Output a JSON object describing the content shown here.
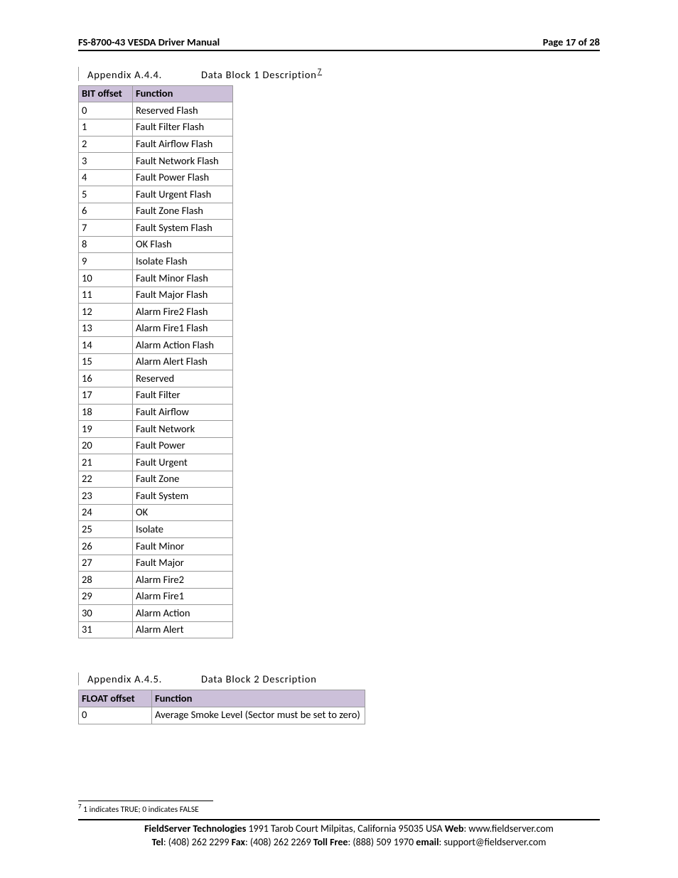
{
  "header": {
    "title": "FS-8700-43 VESDA Driver Manual",
    "page": "Page 17 of 28"
  },
  "section1": {
    "num": "Appendix A.4.4.",
    "title": "Data Block 1 Description",
    "sup": "7",
    "col1": "BIT offset",
    "col2": "Function",
    "rows": [
      {
        "o": "0",
        "f": "Reserved Flash"
      },
      {
        "o": "1",
        "f": "Fault Filter Flash"
      },
      {
        "o": "2",
        "f": "Fault Airflow Flash"
      },
      {
        "o": "3",
        "f": "Fault Network Flash"
      },
      {
        "o": "4",
        "f": "Fault Power Flash"
      },
      {
        "o": "5",
        "f": "Fault Urgent Flash"
      },
      {
        "o": "6",
        "f": "Fault Zone Flash"
      },
      {
        "o": "7",
        "f": "Fault System Flash"
      },
      {
        "o": "8",
        "f": "OK Flash"
      },
      {
        "o": "9",
        "f": "Isolate Flash"
      },
      {
        "o": "10",
        "f": "Fault Minor Flash"
      },
      {
        "o": "11",
        "f": "Fault Major Flash"
      },
      {
        "o": "12",
        "f": "Alarm Fire2 Flash"
      },
      {
        "o": "13",
        "f": "Alarm Fire1 Flash"
      },
      {
        "o": "14",
        "f": "Alarm Action Flash"
      },
      {
        "o": "15",
        "f": "Alarm Alert Flash"
      },
      {
        "o": "16",
        "f": "Reserved"
      },
      {
        "o": "17",
        "f": "Fault Filter"
      },
      {
        "o": "18",
        "f": "Fault Airflow"
      },
      {
        "o": "19",
        "f": "Fault Network"
      },
      {
        "o": "20",
        "f": "Fault Power"
      },
      {
        "o": "21",
        "f": "Fault Urgent"
      },
      {
        "o": "22",
        "f": "Fault Zone"
      },
      {
        "o": "23",
        "f": "Fault System"
      },
      {
        "o": "24",
        "f": "OK"
      },
      {
        "o": "25",
        "f": "Isolate"
      },
      {
        "o": "26",
        "f": "Fault Minor"
      },
      {
        "o": "27",
        "f": "Fault Major"
      },
      {
        "o": "28",
        "f": "Alarm Fire2"
      },
      {
        "o": "29",
        "f": "Alarm Fire1"
      },
      {
        "o": "30",
        "f": "Alarm Action"
      },
      {
        "o": "31",
        "f": "Alarm Alert"
      }
    ]
  },
  "section2": {
    "num": "Appendix A.4.5.",
    "title": "Data Block 2 Description",
    "col1": "FLOAT offset",
    "col2": "Function",
    "rows": [
      {
        "o": "0",
        "f": "Average Smoke Level (Sector must be set to zero)"
      }
    ]
  },
  "footnote": {
    "marker": "7",
    "text": " 1 indicates TRUE; 0 indicates FALSE"
  },
  "footer": {
    "company_lbl": "FieldServer Technologies",
    "company_addr": " 1991 Tarob Court Milpitas, California 95035 USA   ",
    "web_lbl": "Web",
    "web_val": ": www.fieldserver.com",
    "tel_lbl": "Tel",
    "tel_val": ": (408) 262 2299   ",
    "fax_lbl": "Fax",
    "fax_val": ": (408) 262 2269   ",
    "toll_lbl": "Toll Free",
    "toll_val": ": (888) 509 1970   ",
    "email_lbl": "email",
    "email_val": ": support@fieldserver.com"
  }
}
